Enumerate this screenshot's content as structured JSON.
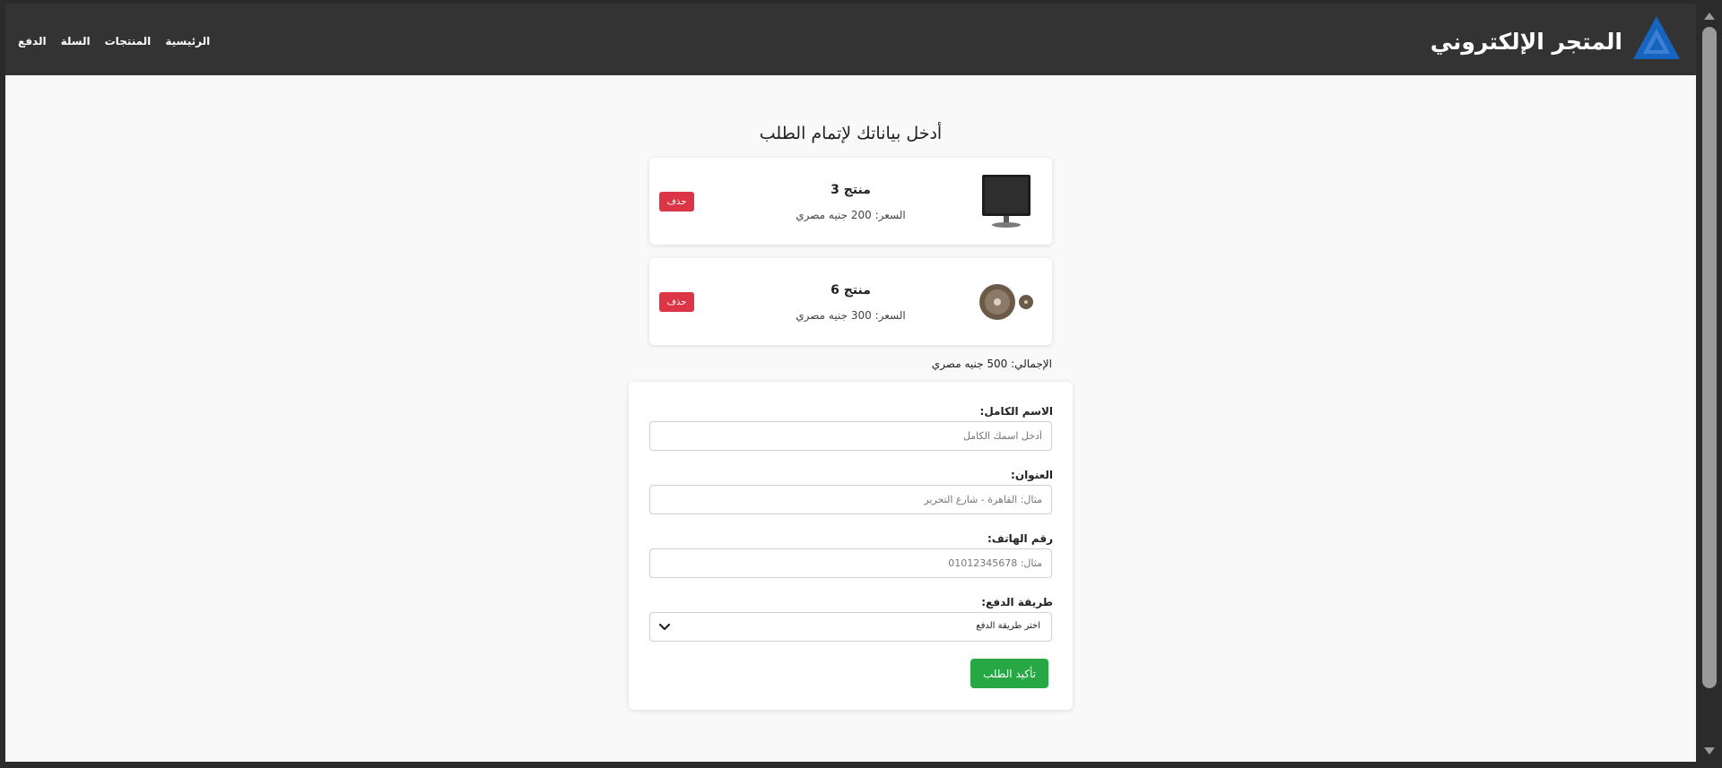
{
  "header": {
    "brand_title": "المتجر الإلكتروني",
    "nav": [
      "الرئيسية",
      "المنتجات",
      "السلة",
      "الدفع"
    ]
  },
  "page": {
    "title": "أدخل بياناتك لإتمام الطلب"
  },
  "cart": {
    "items": [
      {
        "name": "منتج 3",
        "price": "السعر: 200 جنيه مصري",
        "delete_label": "حذف",
        "image": "monitor-icon"
      },
      {
        "name": "منتج 6",
        "price": "السعر: 300 جنيه مصري",
        "delete_label": "حذف",
        "image": "disc-icon"
      }
    ],
    "total": "الإجمالي: 500 جنيه مصري"
  },
  "form": {
    "name_label": "الاسم الكامل:",
    "name_placeholder": "أدخل اسمك الكامل",
    "address_label": "العنوان:",
    "address_placeholder": "مثال: القاهرة - شارع التحرير",
    "phone_label": "رقم الهاتف:",
    "phone_placeholder": "مثال: 01012345678",
    "payment_label": "طريقة الدفع:",
    "payment_selected": "اختر طريقة الدفع",
    "submit_label": "تأكيد الطلب"
  },
  "colors": {
    "header_bg": "#333333",
    "delete": "#dc3545",
    "submit": "#28a745",
    "logo": "#1565c0"
  }
}
